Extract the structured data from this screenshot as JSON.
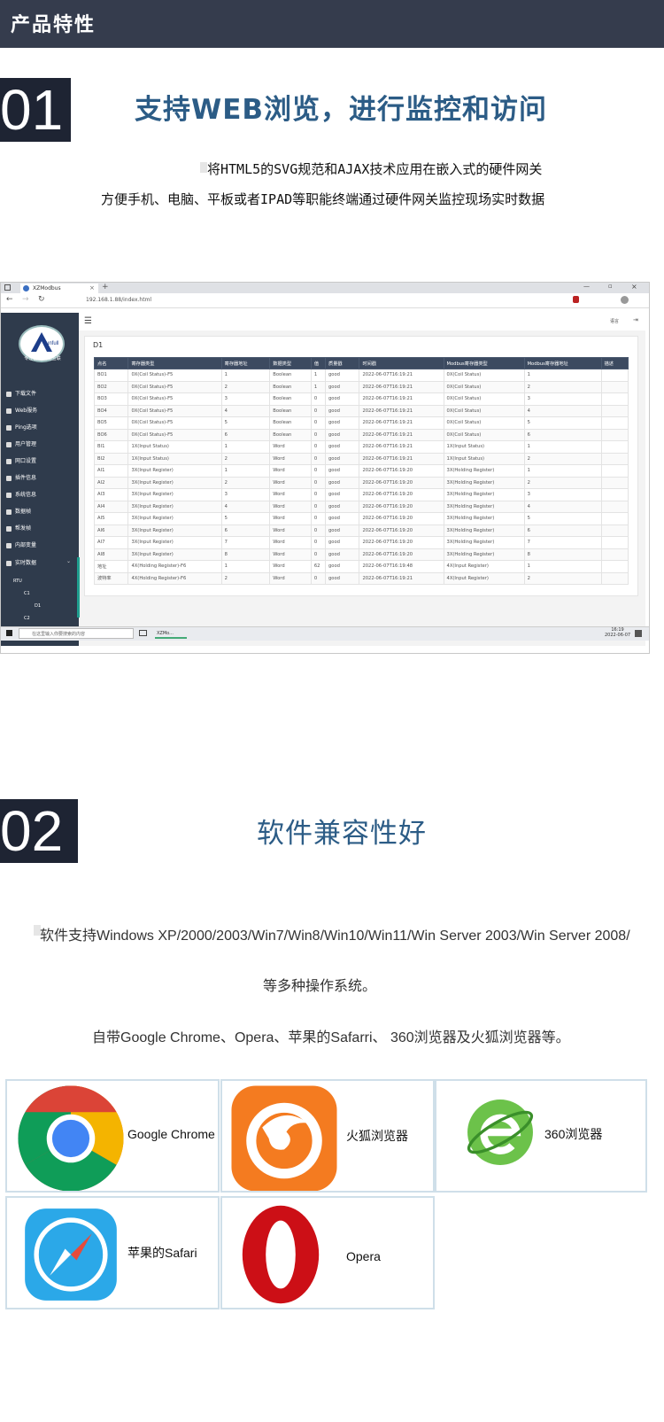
{
  "banner": {
    "title": "产品特性"
  },
  "section1": {
    "number": "01",
    "title": "支持WEB浏览，进行监控和访问",
    "desc_line1": "将HTML5的SVG规范和AJAX技术应用在嵌入式的硬件网关",
    "desc_line2": "方便手机、电脑、平板或者IPAD等职能终端通过硬件网关监控现场实时数据"
  },
  "browser_screenshot": {
    "tab_title": "XZModbus",
    "url": "192.168.1.88/index.html",
    "logo_text": "专注自控 物物互联",
    "logo_brand": "sunfull",
    "menu": [
      {
        "label": "下载文件",
        "icon": "download-icon"
      },
      {
        "label": "Web服务",
        "icon": "globe-icon"
      },
      {
        "label": "Ping选项",
        "icon": "users-icon"
      },
      {
        "label": "用户管理",
        "icon": "users-icon"
      },
      {
        "label": "网口设置",
        "icon": "gear-icon"
      },
      {
        "label": "插件信息",
        "icon": "filter-icon"
      },
      {
        "label": "系统信息",
        "icon": "info-icon"
      },
      {
        "label": "数据帧",
        "icon": "dashboard-icon"
      },
      {
        "label": "帮发帧",
        "icon": "info-icon"
      },
      {
        "label": "内部变量",
        "icon": "eye-icon"
      },
      {
        "label": "实时数据",
        "icon": "database-icon"
      }
    ],
    "tree": [
      "RTU",
      "C1",
      "D1",
      "C2"
    ],
    "lang_menu": "语言",
    "card_title": "D1",
    "table_headers": [
      "点名",
      "寄存器类型",
      "寄存器地址",
      "数据类型",
      "值",
      "质量戳",
      "时间戳",
      "Modbus寄存器类型",
      "Modbus寄存器地址",
      "描述"
    ],
    "table_rows": [
      [
        "BO1",
        "0X(Coil Status)-F5",
        "1",
        "Boolean",
        "1",
        "good",
        "2022-06-07T16:19:21",
        "0X(Coil Status)",
        "1",
        ""
      ],
      [
        "BO2",
        "0X(Coil Status)-F5",
        "2",
        "Boolean",
        "1",
        "good",
        "2022-06-07T16:19:21",
        "0X(Coil Status)",
        "2",
        ""
      ],
      [
        "BO3",
        "0X(Coil Status)-F5",
        "3",
        "Boolean",
        "0",
        "good",
        "2022-06-07T16:19:21",
        "0X(Coil Status)",
        "3",
        ""
      ],
      [
        "BO4",
        "0X(Coil Status)-F5",
        "4",
        "Boolean",
        "0",
        "good",
        "2022-06-07T16:19:21",
        "0X(Coil Status)",
        "4",
        ""
      ],
      [
        "BO5",
        "0X(Coil Status)-F5",
        "5",
        "Boolean",
        "0",
        "good",
        "2022-06-07T16:19:21",
        "0X(Coil Status)",
        "5",
        ""
      ],
      [
        "BO6",
        "0X(Coil Status)-F5",
        "6",
        "Boolean",
        "0",
        "good",
        "2022-06-07T16:19:21",
        "0X(Coil Status)",
        "6",
        ""
      ],
      [
        "BI1",
        "1X(Input Status)",
        "1",
        "Word",
        "0",
        "good",
        "2022-06-07T16:19:21",
        "1X(Input Status)",
        "1",
        ""
      ],
      [
        "BI2",
        "1X(Input Status)",
        "2",
        "Word",
        "0",
        "good",
        "2022-06-07T16:19:21",
        "1X(Input Status)",
        "2",
        ""
      ],
      [
        "AI1",
        "3X(Input Register)",
        "1",
        "Word",
        "0",
        "good",
        "2022-06-07T16:19:20",
        "3X(Holding Register)",
        "1",
        ""
      ],
      [
        "AI2",
        "3X(Input Register)",
        "2",
        "Word",
        "0",
        "good",
        "2022-06-07T16:19:20",
        "3X(Holding Register)",
        "2",
        ""
      ],
      [
        "AI3",
        "3X(Input Register)",
        "3",
        "Word",
        "0",
        "good",
        "2022-06-07T16:19:20",
        "3X(Holding Register)",
        "3",
        ""
      ],
      [
        "AI4",
        "3X(Input Register)",
        "4",
        "Word",
        "0",
        "good",
        "2022-06-07T16:19:20",
        "3X(Holding Register)",
        "4",
        ""
      ],
      [
        "AI5",
        "3X(Input Register)",
        "5",
        "Word",
        "0",
        "good",
        "2022-06-07T16:19:20",
        "3X(Holding Register)",
        "5",
        ""
      ],
      [
        "AI6",
        "3X(Input Register)",
        "6",
        "Word",
        "0",
        "good",
        "2022-06-07T16:19:20",
        "3X(Holding Register)",
        "6",
        ""
      ],
      [
        "AI7",
        "3X(Input Register)",
        "7",
        "Word",
        "0",
        "good",
        "2022-06-07T16:19:20",
        "3X(Holding Register)",
        "7",
        ""
      ],
      [
        "AI8",
        "3X(Input Register)",
        "8",
        "Word",
        "0",
        "good",
        "2022-06-07T16:19:20",
        "3X(Holding Register)",
        "8",
        ""
      ],
      [
        "地址",
        "4X(Holding Register)-F6",
        "1",
        "Word",
        "62",
        "good",
        "2022-06-07T16:19:48",
        "4X(Input Register)",
        "1",
        ""
      ],
      [
        "波特率",
        "4X(Holding Register)-F6",
        "2",
        "Word",
        "0",
        "good",
        "2022-06-07T16:19:21",
        "4X(Input Register)",
        "2",
        ""
      ]
    ],
    "taskbar_search": "在这里输入你要搜索的内容",
    "taskbar_app": "XZMo...",
    "clock_time": "16:19",
    "clock_date": "2022-06-07"
  },
  "section2": {
    "number": "02",
    "title": "软件兼容性好",
    "line1": "软件支持Windows XP/2000/2003/Win7/Win8/Win10/Win11/Win Server 2003/Win Server 2008/",
    "line2": "等多种操作系统。",
    "line3": "自带Google Chrome、Opera、苹果的Safarri、 360浏览器及火狐浏览器等。"
  },
  "browsers": [
    {
      "name": "Google Chrome",
      "icon": "chrome-icon"
    },
    {
      "name": "火狐浏览器",
      "icon": "firefox-icon"
    },
    {
      "name": "360浏览器",
      "icon": "360-browser-icon"
    },
    {
      "name": "苹果的Safari",
      "icon": "safari-icon"
    },
    {
      "name": "Opera",
      "icon": "opera-icon"
    }
  ],
  "colors": {
    "banner": "#353c4d",
    "title_blue": "#2c5c86",
    "number_bg": "#1e2433",
    "tile_border": "#cfdfe9"
  }
}
